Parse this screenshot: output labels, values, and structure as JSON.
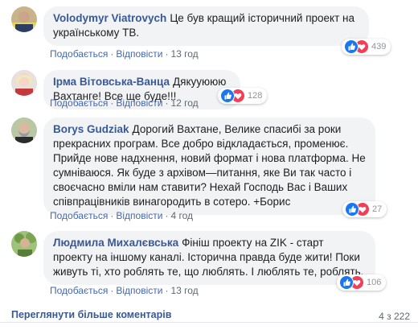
{
  "action_labels": {
    "like": "Подобається",
    "reply": "Відповісти",
    "separator": "·"
  },
  "comments": [
    {
      "author": "Volodymyr Viatrovych",
      "text": "Це був кращий історичний проект на українському ТВ.",
      "time": "13 год",
      "reaction_count": "439",
      "reaction_icons": [
        "like-icon",
        "love-icon"
      ]
    },
    {
      "author": "Ірма Вітовська-Ванца",
      "text": "Дякууююю Вахтанге! Все ще буде!!!",
      "time": "12 год",
      "reaction_count": "128",
      "reaction_icons": [
        "like-icon",
        "love-icon"
      ]
    },
    {
      "author": "Borys Gudziak",
      "text": "Дорогий Вахтане, Велике спасибі за роки прекрасних програм. Все добро відкладається, променює. Прийде нове надхнення, новий формат і нова платформа. Не сумніваюся. Як буде з архівом—питання, яке Ви так часто і своєчасно вміли нам ставити? Нехай Господь Вас і Ваших співпрацівників винагородить в сотеро. +Борис",
      "time": "4 год",
      "reaction_count": "27",
      "reaction_icons": [
        "like-icon",
        "love-icon"
      ]
    },
    {
      "author": "Людмила Михалєвська",
      "text": "Фініш проекту на ZIK - старт проекту на іншому каналі. Історична правда буде жити! Поки живуть ті, хто роблять те, що люблять. І люблять те, роблять.",
      "time": "13 год",
      "reaction_count": "106",
      "reaction_icons": [
        "like-icon",
        "love-icon"
      ]
    }
  ],
  "footer": {
    "more_comments": "Переглянути більше коментарів",
    "pager": "4 з 222"
  },
  "colors": {
    "author": "#385898",
    "link": "#4267b2",
    "bubble": "#f2f3f5",
    "like": "#1877f2",
    "love": "#f33e58"
  }
}
